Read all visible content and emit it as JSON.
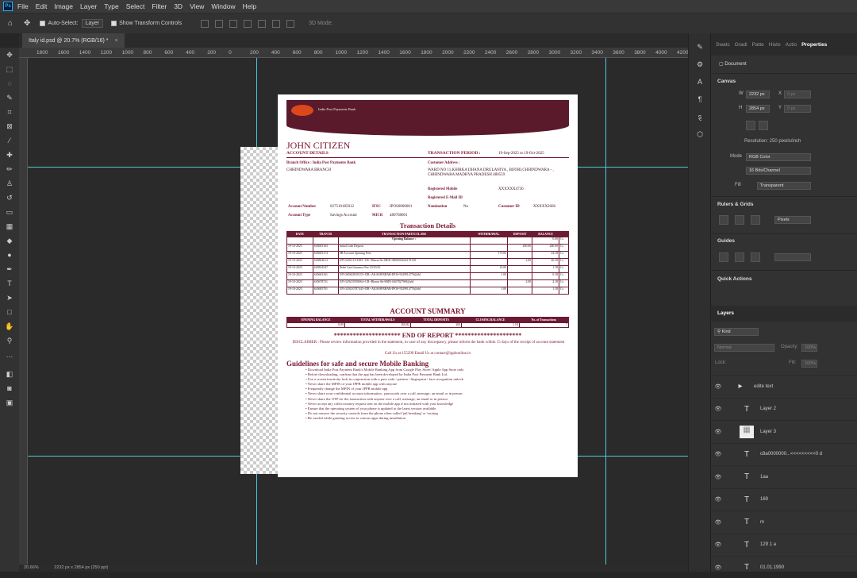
{
  "menu": {
    "logo": "Ps",
    "items": [
      "File",
      "Edit",
      "Image",
      "Layer",
      "Type",
      "Select",
      "Filter",
      "3D",
      "View",
      "Window",
      "Help"
    ]
  },
  "options": {
    "auto_select": "Auto-Select:",
    "layer": "Layer",
    "show_transform": "Show Transform Controls",
    "mode_3d": "3D Mode:"
  },
  "tab": {
    "title": "Italy id.psd @ 20.7% (RGB/16) *",
    "close": "×"
  },
  "ruler": [
    "1800",
    "1600",
    "1400",
    "1200",
    "1000",
    "800",
    "600",
    "400",
    "200",
    "0",
    "200",
    "400",
    "600",
    "800",
    "1000",
    "1200",
    "1400",
    "1600",
    "1800",
    "2000",
    "2200",
    "2400",
    "2600",
    "2800",
    "3000",
    "3200",
    "3400",
    "3600",
    "3800",
    "4000",
    "4200"
  ],
  "doc": {
    "logo_text": "India Post Payments Bank",
    "name": "JOHN CITIZEN",
    "account_details": "ACCOUNT DETAILS",
    "txn_period_label": "TRANSACTION PERIOD :",
    "txn_period": "19-Sep-2025 to 19-Oct-2025",
    "branch_label": "Branch Office : India Post Payments Bank",
    "branch": "CHHINDWARA BRANCH",
    "cust_addr_label": "Customer Address :",
    "cust_addr": "WARD NO 11,KHIRKA DHANA DRULANIYA , BIJORI,CHHINDWARA - , CHHINDWARA MADHYA PRADESH 480559",
    "reg_mobile_label": "Registered Mobile",
    "reg_mobile": "XXXXXX4736",
    "reg_email_label": "Registered E-Mail ID",
    "acct_no_label": "Account Number",
    "acct_no": "027510185012",
    "ifsc_label": "IFSC",
    "ifsc": "IPOS0000001",
    "nomination_label": "Nomination",
    "nomination": "No",
    "cust_id_label": "Customer ID",
    "cust_id": "XXXXX2666",
    "acct_type_label": "Account Type",
    "acct_type": "Savings Account",
    "micr_label": "MICR",
    "micr": "480768001",
    "txn_title": "Transaction Details",
    "txn_headers": [
      "DATE",
      "TRAN ID",
      "TRANSACTION PARTICULARS",
      "WITHDRAWAL",
      "DEPOSIT",
      "BALANCE",
      ""
    ],
    "txn_rows": [
      [
        "",
        "",
        "Opening Balance :",
        "",
        "",
        "0.00",
        "Cr."
      ],
      [
        "19-10-2025",
        "S45603163",
        "Initial Cash Deposit",
        "",
        "200.00",
        "200.00",
        "Cr."
      ],
      [
        "19-10-2025",
        "S45603174",
        "SB Account Opening Fees",
        "175.82",
        "",
        "24.18",
        "Cr."
      ],
      [
        "19-10-2025",
        "S45804613",
        "UPI-329211111083--CR--Bharat Sh-SBIN-0000000040178138",
        "",
        "2.00",
        "26.18",
        "Cr."
      ],
      [
        "19-10-2025",
        "S45834547",
        "Debit Card Issuance Fee 19/10/25",
        "25.00",
        "",
        "1.18",
        "Cr."
      ],
      [
        "19-10-2025",
        "S45603161",
        "UPI-365823818155--DR--AKASH BHAR-IPOS-9329914776@ibl",
        "1.00",
        "",
        "0.18",
        "Cr."
      ],
      [
        "19-10-2025",
        "S45678721",
        "UPI-329219558064--CR--Bharat Sh-SBIN-0407827969@ybl",
        "",
        "2.00",
        "2.18",
        "Cr."
      ],
      [
        "19-10-2025",
        "S45685701",
        "UPI-329210787443--DR--AKASH BHAR-IPOS-9329914776@ibl",
        "1.00",
        "",
        "1.18",
        "Cr."
      ]
    ],
    "summary_title": "ACCOUNT SUMMARY",
    "summary_headers": [
      "OPENING BALANCE",
      "TOTAL WITHDRAWALS",
      "TOTAL DEPOSITS",
      "CLOSING BALANCE",
      "No. of Transactions"
    ],
    "summary_values": [
      "0.00",
      "202.82",
      "204",
      "1.18",
      "7"
    ],
    "end_report": "********************* END OF REPORT *********************",
    "disclaimer": "DISCLAIMER : Please review information provided in the statement, in case of any discrepancy, please inform the bank within 15 days of the receipt of account statement",
    "contact": "Call Us at 155299 Email Us at contact@ippbonline.in",
    "guidelines_title": "Guidelines for safe and secure Mobile Banking",
    "guidelines": [
      "Download India Post Payment Bank's Mobile Banking App from Google Play Store/ Apple App Store only",
      "Before downloading, confirm that the app has been developed by India Post Payment Bank Ltd.",
      "Use a screen inactivity lock in conjunction with a pass code / pattern / fingerprint / face recognition unlock",
      "Never share the MPIN of your IPPB mobile app with anyone",
      "Frequently change the MPIN of your IPPB mobile app",
      "Never share your confidential account information , passwords over a call, message, an email or in person",
      "Never share the OTP for the transaction with anyone over a call, message, an email or in person",
      "Never accept any collect money request sent on the mobile app if not initiated with your knowledge",
      "Ensure that the operating system of your phone is updated to the latest version available",
      "Do not remove the security controls from the phone often called 'jail breaking' or 'rooting",
      "Be careful while granting access to various apps during installation"
    ]
  },
  "panel": {
    "tabs": [
      "Swatc",
      "Gradi",
      "Patte",
      "Histo",
      "Actio",
      "Properties"
    ],
    "document": "Document",
    "canvas": "Canvas",
    "w_label": "W",
    "w": "2232 px",
    "h_label": "H",
    "h": "2854 px",
    "x_label": "X",
    "y_label": "Y",
    "x_ph": "0 px",
    "y_ph": "0 px",
    "resolution": "Resolution: 250 pixels/inch",
    "mode_label": "Mode",
    "mode": "RGB Color",
    "bits": "16 Bits/Channel",
    "fill_label": "Fill",
    "fill": "Transparent",
    "rulers_grids": "Rulers & Grids",
    "units": "Pixels",
    "guides": "Guides",
    "quick_actions": "Quick Actions",
    "layers_title": "Layers",
    "kind": "Kind",
    "blend": "Normal",
    "opacity_label": "Opacity:",
    "opacity": "100%",
    "lock_label": "Lock:",
    "fill2_label": "Fill:",
    "fill2": "100%",
    "layers": [
      {
        "name": "edite text",
        "type": "folder"
      },
      {
        "name": "Layer 2",
        "type": "text"
      },
      {
        "name": "Layer 3",
        "type": "image"
      },
      {
        "name": "c8a0000000...<<<<<<<<<0 d",
        "type": "text"
      },
      {
        "name": "1aa",
        "type": "text"
      },
      {
        "name": "169",
        "type": "text"
      },
      {
        "name": "m",
        "type": "text"
      },
      {
        "name": "129 1 a",
        "type": "text"
      },
      {
        "name": "01.01.1990",
        "type": "text"
      }
    ]
  },
  "status": {
    "zoom": "20.66%",
    "size": "2232 px x 2854 px (250 ppi)"
  }
}
